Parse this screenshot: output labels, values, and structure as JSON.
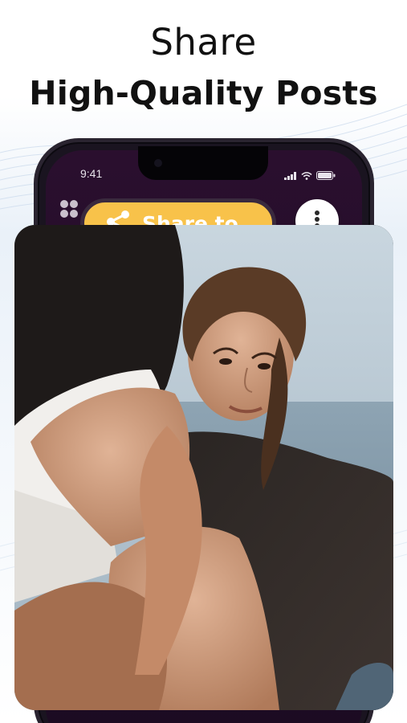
{
  "headline": {
    "line1": "Share",
    "line2": "High-Quality Posts"
  },
  "phone": {
    "status_time": "9:41",
    "grid_icon": "grid-icon",
    "menu_icon": "more-vertical-icon",
    "status_icons": [
      "signal-icon",
      "wifi-icon",
      "battery-icon"
    ]
  },
  "share": {
    "label": "Share to",
    "icon": "share-icon",
    "color": "#f8c24a"
  },
  "photo": {
    "subject": "photo"
  }
}
